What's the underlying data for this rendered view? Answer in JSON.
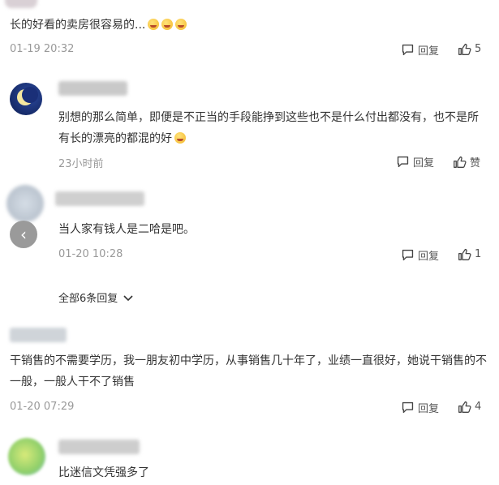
{
  "comments": [
    {
      "text": "长的好看的卖房很容易的...",
      "time": "01-19 20:32",
      "reply_label": "回复",
      "like_count": "5"
    },
    {
      "text": "别想的那么简单，即便是不正当的手段能挣到这些也不是什么付出都没有，也不是所有长的漂亮的都混的好",
      "time": "23小时前",
      "reply_label": "回复",
      "like_label": "赞"
    },
    {
      "text": "当人家有钱人是二哈是吧。",
      "time": "01-20 10:28",
      "reply_label": "回复",
      "like_count": "1"
    },
    {
      "text": "干销售的不需要学历，我一朋友初中学历，从事销售几十年了，业绩一直很好，她说干销售的不一般，一般人干不了销售",
      "time": "01-20 07:29",
      "reply_label": "回复",
      "like_count": "4"
    },
    {
      "text": "比迷信文凭强多了"
    }
  ],
  "replies_toggle": "全部6条回复",
  "nav_prev_glyph": "‹",
  "colors": {
    "meta": "#999999",
    "text": "#333333"
  }
}
